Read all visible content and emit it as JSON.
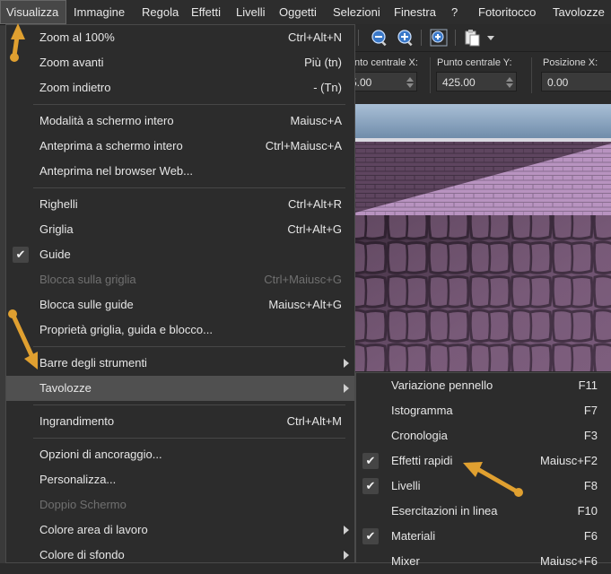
{
  "menubar": [
    {
      "label": "Visualizza",
      "active": true
    },
    {
      "label": "Immagine"
    },
    {
      "label": "Regola"
    },
    {
      "label": "Effetti"
    },
    {
      "label": "Livelli"
    },
    {
      "label": "Oggetti"
    },
    {
      "label": "Selezioni"
    },
    {
      "label": "Finestra"
    },
    {
      "label": "?"
    },
    {
      "label": "Fotoritocco"
    },
    {
      "label": "Tavolozze"
    }
  ],
  "toolbar": {
    "icons": [
      "zoom-out-icon",
      "zoom-in-icon",
      "zoom-fit-icon",
      "clipboard-icon"
    ]
  },
  "properties": {
    "center_x_label": "nto centrale X:",
    "center_x_value": "5.00",
    "center_y_label": "Punto centrale Y:",
    "center_y_value": "425.00",
    "position_x_label": "Posizione X:",
    "position_x_value": "0.00"
  },
  "visualizza_menu": {
    "items": [
      {
        "label": "Zoom al 100%",
        "shortcut": "Ctrl+Alt+N"
      },
      {
        "label": "Zoom avanti",
        "shortcut": "Più (tn)"
      },
      {
        "label": "Zoom indietro",
        "shortcut": "- (Tn)"
      },
      {
        "separator": true
      },
      {
        "label": "Modalità a schermo intero",
        "shortcut": "Maiusc+A"
      },
      {
        "label": "Anteprima a schermo intero",
        "shortcut": "Ctrl+Maiusc+A"
      },
      {
        "label": "Anteprima nel browser Web...",
        "shortcut": ""
      },
      {
        "separator": true
      },
      {
        "label": "Righelli",
        "shortcut": "Ctrl+Alt+R"
      },
      {
        "label": "Griglia",
        "shortcut": "Ctrl+Alt+G"
      },
      {
        "label": "Guide",
        "shortcut": "",
        "checked": true
      },
      {
        "label": "Blocca sulla griglia",
        "shortcut": "Ctrl+Maiusc+G",
        "disabled": true
      },
      {
        "label": "Blocca sulle guide",
        "shortcut": "Maiusc+Alt+G"
      },
      {
        "label": "Proprietà griglia, guida e blocco...",
        "shortcut": ""
      },
      {
        "separator": true
      },
      {
        "label": "Barre degli strumenti",
        "shortcut": "",
        "submenu": true
      },
      {
        "label": "Tavolozze",
        "shortcut": "",
        "submenu": true,
        "highlight": true
      },
      {
        "separator": true
      },
      {
        "label": "Ingrandimento",
        "shortcut": "Ctrl+Alt+M"
      },
      {
        "separator": true
      },
      {
        "label": "Opzioni di ancoraggio...",
        "shortcut": ""
      },
      {
        "label": "Personalizza...",
        "shortcut": ""
      },
      {
        "label": "Doppio Schermo",
        "shortcut": "",
        "disabled": true
      },
      {
        "label": "Colore area di lavoro",
        "shortcut": "",
        "submenu": true
      },
      {
        "label": "Colore di sfondo",
        "shortcut": "",
        "submenu": true
      }
    ]
  },
  "tavolozze_menu": {
    "items": [
      {
        "label": "Variazione pennello",
        "shortcut": "F11"
      },
      {
        "label": "Istogramma",
        "shortcut": "F7"
      },
      {
        "label": "Cronologia",
        "shortcut": "F3"
      },
      {
        "label": "Effetti rapidi",
        "shortcut": "Maiusc+F2",
        "checked": true
      },
      {
        "label": "Livelli",
        "shortcut": "F8",
        "checked": true
      },
      {
        "label": "Esercitazioni in linea",
        "shortcut": "F10"
      },
      {
        "label": "Materiali",
        "shortcut": "F6",
        "checked": true
      },
      {
        "label": "Mixer",
        "shortcut": "Maiusc+F6"
      }
    ]
  },
  "colors": {
    "menu_bg": "#2c2c2c",
    "highlight": "#505050",
    "annotation_arrow": "#e0a030",
    "canvas_tile": "#6f5370",
    "canvas_light": "#b893c0"
  }
}
